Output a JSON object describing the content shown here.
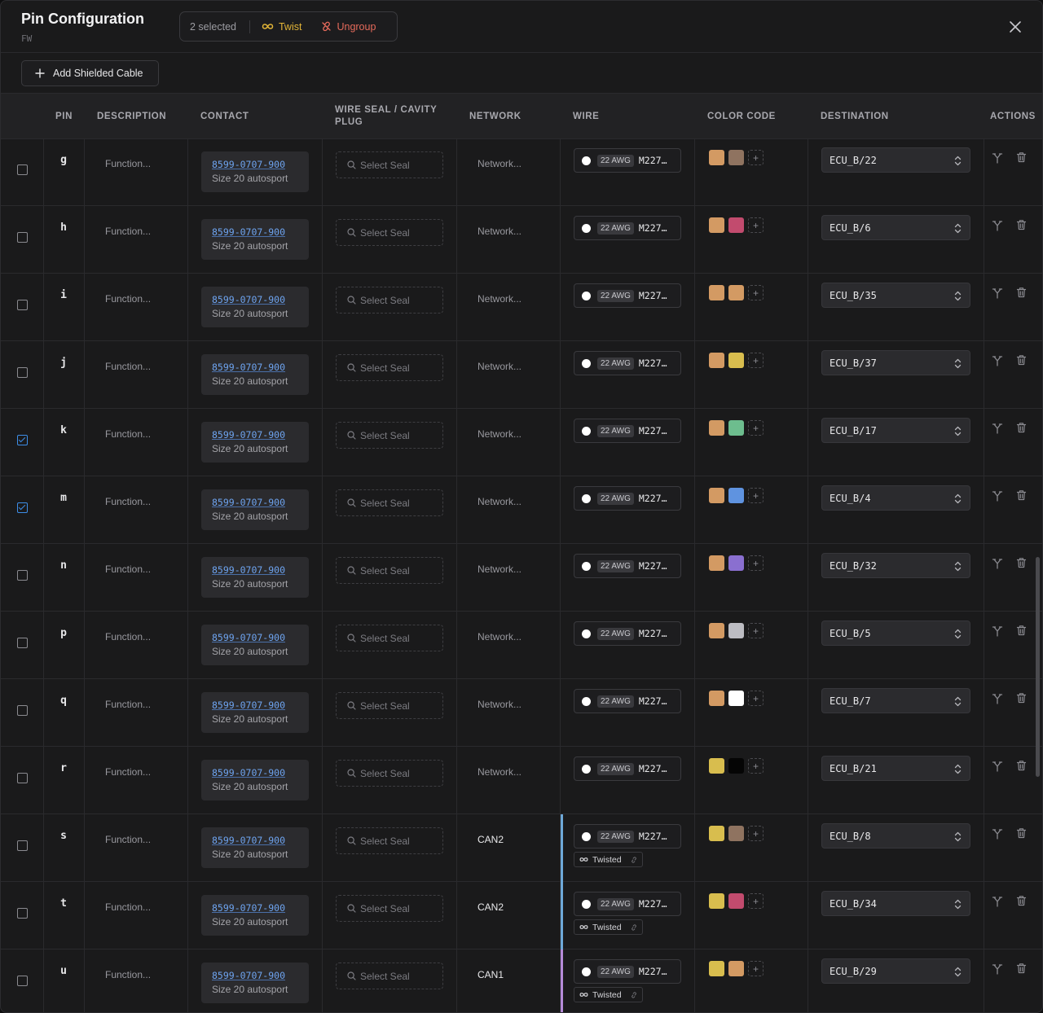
{
  "header": {
    "title": "Pin Configuration",
    "subtitle": "FW",
    "selection": {
      "count_label": "2 selected",
      "twist_label": "Twist",
      "ungroup_label": "Ungroup"
    }
  },
  "toolbar": {
    "add_shielded_label": "Add Shielded Cable"
  },
  "columns": {
    "pin": "PIN",
    "description": "DESCRIPTION",
    "contact": "CONTACT",
    "seal_line1": "WIRE SEAL / CAVITY",
    "seal_line2": "PLUG",
    "network": "NETWORK",
    "wire": "WIRE",
    "color_code": "COLOR CODE",
    "destination": "DESTINATION",
    "actions": "ACTIONS"
  },
  "colors": {
    "twist_bar_can2": "#6ea8d8",
    "twist_bar_can1": "#b58ad8",
    "accent_blue": "#3d8ee8"
  },
  "rows": [
    {
      "pin": "g",
      "checked": false,
      "description": "Function...",
      "contact_pn": "8599-0707-900",
      "contact_size": "Size 20 autosport",
      "seal": "Select Seal",
      "network": "Network...",
      "network_set": false,
      "awg": "22 AWG",
      "wire_code": "M227…",
      "colors": [
        "#d39a63",
        "#8f7360"
      ],
      "destination": "ECU_B/22",
      "twisted": null
    },
    {
      "pin": "h",
      "checked": false,
      "description": "Function...",
      "contact_pn": "8599-0707-900",
      "contact_size": "Size 20 autosport",
      "seal": "Select Seal",
      "network": "Network...",
      "network_set": false,
      "awg": "22 AWG",
      "wire_code": "M227…",
      "colors": [
        "#d39a63",
        "#c24b6e"
      ],
      "destination": "ECU_B/6",
      "twisted": null
    },
    {
      "pin": "i",
      "checked": false,
      "description": "Function...",
      "contact_pn": "8599-0707-900",
      "contact_size": "Size 20 autosport",
      "seal": "Select Seal",
      "network": "Network...",
      "network_set": false,
      "awg": "22 AWG",
      "wire_code": "M227…",
      "colors": [
        "#d39a63",
        "#d39a63"
      ],
      "destination": "ECU_B/35",
      "twisted": null
    },
    {
      "pin": "j",
      "checked": false,
      "description": "Function...",
      "contact_pn": "8599-0707-900",
      "contact_size": "Size 20 autosport",
      "seal": "Select Seal",
      "network": "Network...",
      "network_set": false,
      "awg": "22 AWG",
      "wire_code": "M227…",
      "colors": [
        "#d39a63",
        "#d8bd4e"
      ],
      "destination": "ECU_B/37",
      "twisted": null
    },
    {
      "pin": "k",
      "checked": true,
      "description": "Function...",
      "contact_pn": "8599-0707-900",
      "contact_size": "Size 20 autosport",
      "seal": "Select Seal",
      "network": "Network...",
      "network_set": false,
      "awg": "22 AWG",
      "wire_code": "M227…",
      "colors": [
        "#d39a63",
        "#6dbd8e"
      ],
      "destination": "ECU_B/17",
      "twisted": null
    },
    {
      "pin": "m",
      "checked": true,
      "description": "Function...",
      "contact_pn": "8599-0707-900",
      "contact_size": "Size 20 autosport",
      "seal": "Select Seal",
      "network": "Network...",
      "network_set": false,
      "awg": "22 AWG",
      "wire_code": "M227…",
      "colors": [
        "#d39a63",
        "#5f93e0"
      ],
      "destination": "ECU_B/4",
      "twisted": null
    },
    {
      "pin": "n",
      "checked": false,
      "description": "Function...",
      "contact_pn": "8599-0707-900",
      "contact_size": "Size 20 autosport",
      "seal": "Select Seal",
      "network": "Network...",
      "network_set": false,
      "awg": "22 AWG",
      "wire_code": "M227…",
      "colors": [
        "#d39a63",
        "#8a6fd0"
      ],
      "destination": "ECU_B/32",
      "twisted": null
    },
    {
      "pin": "p",
      "checked": false,
      "description": "Function...",
      "contact_pn": "8599-0707-900",
      "contact_size": "Size 20 autosport",
      "seal": "Select Seal",
      "network": "Network...",
      "network_set": false,
      "awg": "22 AWG",
      "wire_code": "M227…",
      "colors": [
        "#d39a63",
        "#bcbcc2"
      ],
      "destination": "ECU_B/5",
      "twisted": null
    },
    {
      "pin": "q",
      "checked": false,
      "description": "Function...",
      "contact_pn": "8599-0707-900",
      "contact_size": "Size 20 autosport",
      "seal": "Select Seal",
      "network": "Network...",
      "network_set": false,
      "awg": "22 AWG",
      "wire_code": "M227…",
      "colors": [
        "#d39a63",
        "#ffffff"
      ],
      "destination": "ECU_B/7",
      "twisted": null
    },
    {
      "pin": "r",
      "checked": false,
      "description": "Function...",
      "contact_pn": "8599-0707-900",
      "contact_size": "Size 20 autosport",
      "seal": "Select Seal",
      "network": "Network...",
      "network_set": false,
      "awg": "22 AWG",
      "wire_code": "M227…",
      "colors": [
        "#d8bd4e",
        "#050505"
      ],
      "destination": "ECU_B/21",
      "twisted": null
    },
    {
      "pin": "s",
      "checked": false,
      "description": "Function...",
      "contact_pn": "8599-0707-900",
      "contact_size": "Size 20 autosport",
      "seal": "Select Seal",
      "network": "CAN2",
      "network_set": true,
      "awg": "22 AWG",
      "wire_code": "M227…",
      "colors": [
        "#d8bd4e",
        "#8f7360"
      ],
      "destination": "ECU_B/8",
      "twisted": "Twisted",
      "twist_color": "#6ea8d8"
    },
    {
      "pin": "t",
      "checked": false,
      "description": "Function...",
      "contact_pn": "8599-0707-900",
      "contact_size": "Size 20 autosport",
      "seal": "Select Seal",
      "network": "CAN2",
      "network_set": true,
      "awg": "22 AWG",
      "wire_code": "M227…",
      "colors": [
        "#d8bd4e",
        "#c24b6e"
      ],
      "destination": "ECU_B/34",
      "twisted": "Twisted",
      "twist_color": "#6ea8d8"
    },
    {
      "pin": "u",
      "checked": false,
      "description": "Function...",
      "contact_pn": "8599-0707-900",
      "contact_size": "Size 20 autosport",
      "seal": "Select Seal",
      "network": "CAN1",
      "network_set": true,
      "awg": "22 AWG",
      "wire_code": "M227…",
      "colors": [
        "#d8bd4e",
        "#d39a63"
      ],
      "destination": "ECU_B/29",
      "twisted": "Twisted",
      "twist_color": "#b58ad8"
    }
  ]
}
